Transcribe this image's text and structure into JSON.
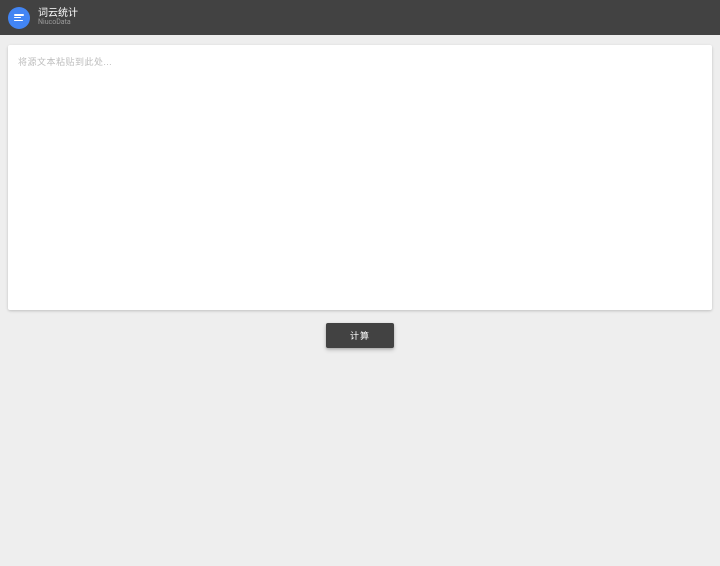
{
  "header": {
    "title": "词云统计",
    "subtitle": "NiucoData"
  },
  "main": {
    "textarea_placeholder": "将源文本粘贴到此处...",
    "button_label": "计算"
  }
}
